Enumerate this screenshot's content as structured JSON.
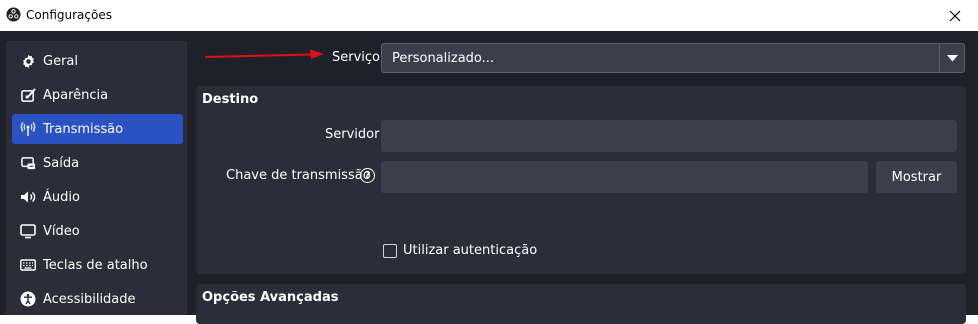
{
  "window": {
    "title": "Configurações"
  },
  "sidebar": {
    "items": [
      {
        "label": "Geral",
        "icon": "gear-icon",
        "active": false
      },
      {
        "label": "Aparência",
        "icon": "appearance-icon",
        "active": false
      },
      {
        "label": "Transmissão",
        "icon": "broadcast-antenna-icon",
        "active": true
      },
      {
        "label": "Saída",
        "icon": "output-icon",
        "active": false
      },
      {
        "label": "Áudio",
        "icon": "speaker-icon",
        "active": false
      },
      {
        "label": "Vídeo",
        "icon": "monitor-icon",
        "active": false
      },
      {
        "label": "Teclas de atalho",
        "icon": "keyboard-icon",
        "active": false
      },
      {
        "label": "Acessibilidade",
        "icon": "accessibility-icon",
        "active": false
      }
    ]
  },
  "service": {
    "label": "Serviço",
    "value": "Personalizado..."
  },
  "destination": {
    "title": "Destino",
    "server_label": "Servidor",
    "server_value": "",
    "key_label": "Chave de transmissão",
    "key_value": "",
    "show_button": "Mostrar",
    "auth_label": "Utilizar autenticação",
    "auth_checked": false
  },
  "advanced": {
    "title": "Opções Avançadas"
  },
  "colors": {
    "background": "#1f212a",
    "panel": "#2b2e38",
    "field": "#3b3e4b",
    "active": "#2b52c4",
    "annotation_arrow": "#e01010"
  }
}
